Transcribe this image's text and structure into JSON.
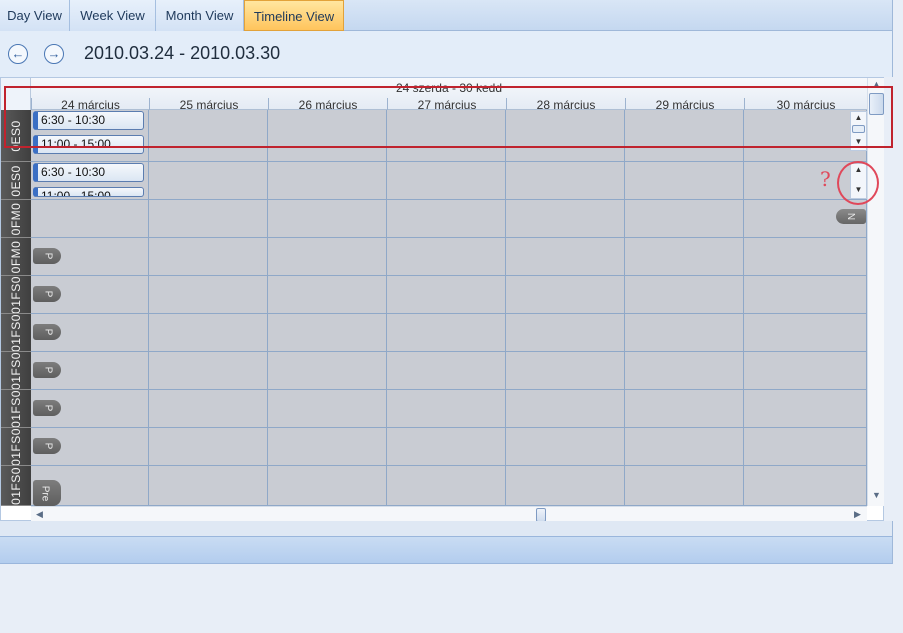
{
  "tabs": [
    {
      "label": "Day View",
      "active": false
    },
    {
      "label": "Week View",
      "active": false
    },
    {
      "label": "Month View",
      "active": false
    },
    {
      "label": "Timeline View",
      "active": true
    }
  ],
  "nav": {
    "prev_icon": "arrow-left-icon",
    "next_icon": "arrow-right-icon",
    "date_range": "2010.03.24 - 2010.03.30"
  },
  "timeline": {
    "header_title": "24 szerda - 30 kedd",
    "days": [
      "24 március",
      "25 március",
      "26 március",
      "27 március",
      "28 március",
      "29 március",
      "30 március"
    ],
    "resources": [
      {
        "name": "0ES0",
        "appointments": [
          "6:30 - 10:30",
          "11:00 - 15:00"
        ]
      },
      {
        "name": "0ES0",
        "appointments": [
          "6:30 - 10:30",
          "11:00 - 15:00"
        ]
      },
      {
        "name": "0FM0",
        "more_label": "N"
      },
      {
        "name": "0FM0",
        "pill": "P"
      },
      {
        "name": "01FS0",
        "pill": "P"
      },
      {
        "name": "01FS0",
        "pill": "P"
      },
      {
        "name": "01FS0",
        "pill": "P"
      },
      {
        "name": "01FS0",
        "pill": "P"
      },
      {
        "name": "01FS0",
        "pill": "P"
      },
      {
        "name": "01FS0",
        "pill": "Pre"
      }
    ]
  },
  "annotation": {
    "question_mark": "?"
  },
  "colors": {
    "accent_tab": "#ffc45c",
    "annotation_red": "#c0232e",
    "cell_bg": "#c9ccd3"
  }
}
